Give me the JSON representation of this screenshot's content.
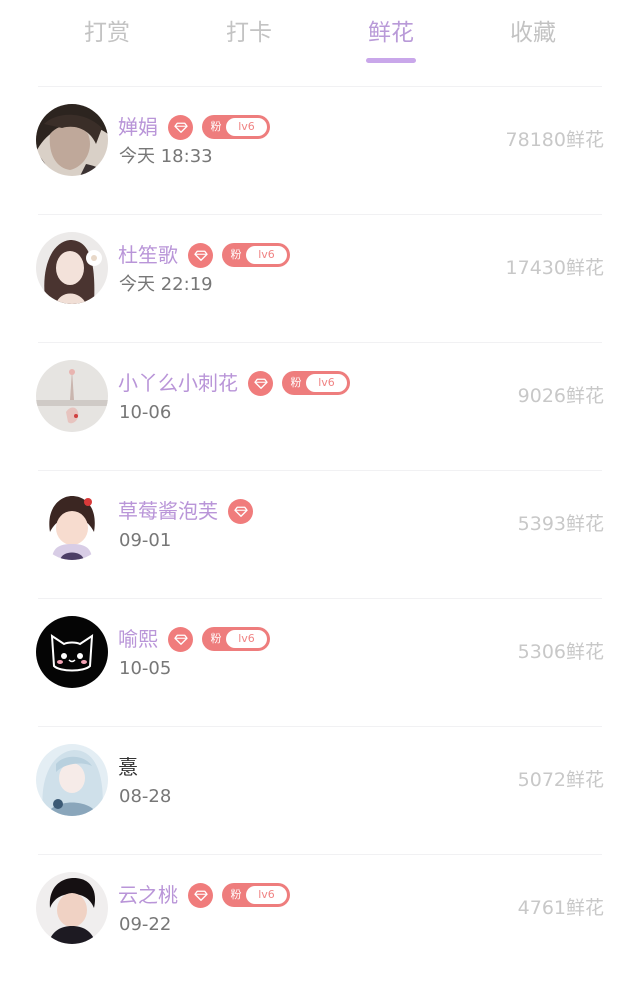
{
  "tabs": [
    {
      "label": "打赏",
      "active": false
    },
    {
      "label": "打卡",
      "active": false
    },
    {
      "label": "鲜花",
      "active": true
    },
    {
      "label": "收藏",
      "active": false
    }
  ],
  "colors": {
    "accent": "#b995d8",
    "tab_inactive": "#c3c3c3",
    "badge": "#ee7d7d",
    "count": "#c8c8c8"
  },
  "rows": [
    {
      "name": "婵娟",
      "time": "今天 18:33",
      "flowers": "78180鲜花",
      "fan_label": "粉",
      "fan_level": "lv6"
    },
    {
      "name": "杜笙歌",
      "time": "今天 22:19",
      "flowers": "17430鲜花",
      "fan_label": "粉",
      "fan_level": "lv6"
    },
    {
      "name": "小丫么小刺花",
      "time": "10-06",
      "flowers": "9026鲜花",
      "fan_label": "粉",
      "fan_level": "lv6"
    },
    {
      "name": "草莓酱泡芙",
      "time": "09-01",
      "flowers": "5393鲜花"
    },
    {
      "name": "喻熙",
      "time": "10-05",
      "flowers": "5306鲜花",
      "fan_label": "粉",
      "fan_level": "lv6"
    },
    {
      "name": "憙",
      "time": "08-28",
      "flowers": "5072鲜花"
    },
    {
      "name": "云之桃",
      "time": "09-22",
      "flowers": "4761鲜花",
      "fan_label": "粉",
      "fan_level": "lv6"
    }
  ]
}
